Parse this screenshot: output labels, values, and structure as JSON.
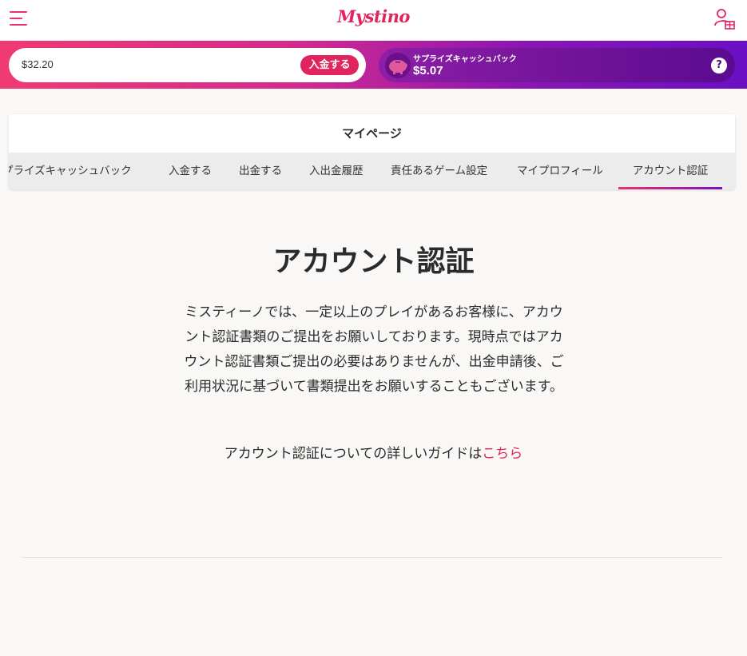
{
  "header": {
    "logo_text": "Mystino",
    "menu_icon": "hamburger-menu-icon",
    "user_icon": "user-gift-icon"
  },
  "balance": {
    "amount": "$32.20",
    "deposit_label": "入金する"
  },
  "cashback": {
    "label": "サプライズキャッシュバック",
    "amount": "$5.07",
    "help_label": "?",
    "pig_icon": "piggy-bank-icon"
  },
  "mypage": {
    "title": "マイページ",
    "tabs": [
      {
        "label": "プライズキャッシュバック",
        "active": false
      },
      {
        "label": "入金する",
        "active": false
      },
      {
        "label": "出金する",
        "active": false
      },
      {
        "label": "入出金履歴",
        "active": false
      },
      {
        "label": "責任あるゲーム設定",
        "active": false
      },
      {
        "label": "マイプロフィール",
        "active": false
      },
      {
        "label": "アカウント認証",
        "active": true
      }
    ]
  },
  "main": {
    "title": "アカウント認証",
    "body": "ミスティーノでは、一定以上のプレイがあるお客様に、アカウント認証書類のご提出をお願いしております。現時点ではアカウント認証書類ご提出の必要はありませんが、出金申請後、ご利用状況に基づいて書類提出をお願いすることもございます。",
    "guide_prefix": "アカウント認証についての詳しいガイドは",
    "guide_link": "こちら"
  },
  "colors": {
    "brand": "#e0245e",
    "purple": "#6a0fc4",
    "background": "#f9f8f6"
  }
}
